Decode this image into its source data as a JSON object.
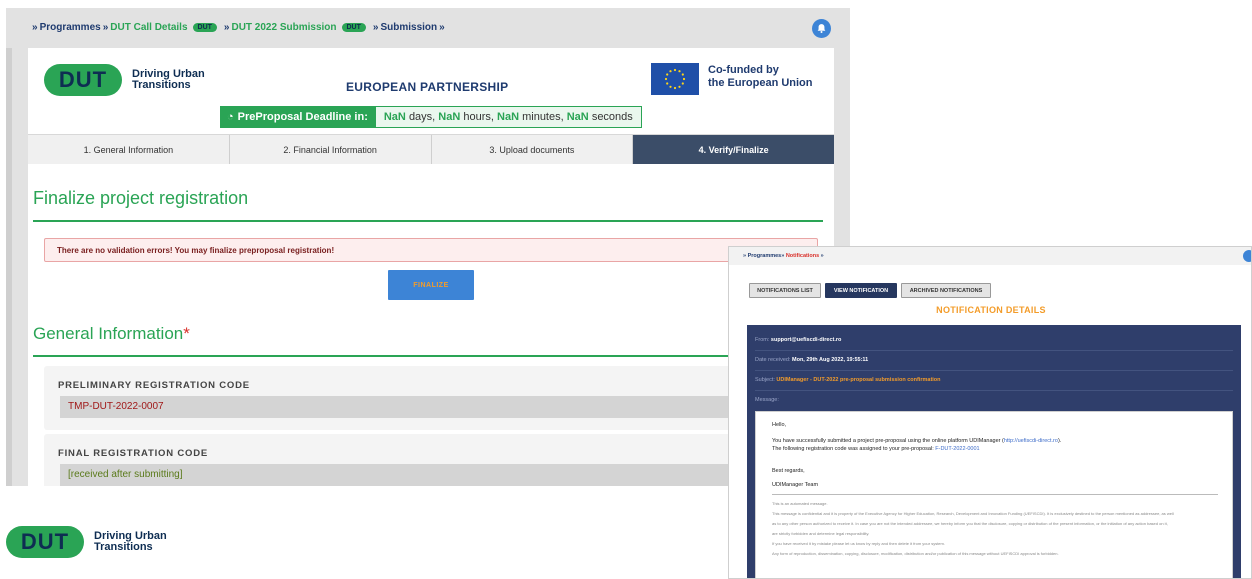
{
  "main": {
    "breadcrumb": {
      "sep1": "»",
      "programmes": "Programmes",
      "sep2": "»",
      "call_details": "DUT Call Details",
      "pill1": "DUT",
      "sep3": "»",
      "submission_2022": "DUT 2022 Submission",
      "pill2": "DUT",
      "sep4": "»",
      "submission": "Submission",
      "sep5": "»"
    },
    "logo": {
      "mark": "DUT",
      "line1": "Driving Urban",
      "line2": "Transitions"
    },
    "partnership_title": "EUROPEAN PARTNERSHIP",
    "cofunded": {
      "line1": "Co-funded by",
      "line2": "the European Union"
    },
    "deadline": {
      "label": "PreProposal Deadline in:",
      "days_val": "NaN",
      "days_unit": "days,",
      "hours_val": "NaN",
      "hours_unit": "hours,",
      "minutes_val": "NaN",
      "minutes_unit": "minutes,",
      "seconds_val": "NaN",
      "seconds_unit": "seconds"
    },
    "tabs": [
      {
        "label": "1. General Information"
      },
      {
        "label": "2. Financial Information"
      },
      {
        "label": "3. Upload documents"
      },
      {
        "label": "4. Verify/Finalize"
      }
    ],
    "finalize_heading": "Finalize project registration",
    "alert_text": "There are no validation errors! You may finalize preproposal registration!",
    "finalize_button": "FINALIZE",
    "general_heading": "General Information",
    "required_mark": "*",
    "fields": [
      {
        "label": "PRELIMINARY REGISTRATION CODE",
        "value": "TMP-DUT-2022-0007"
      },
      {
        "label": "FINAL REGISTRATION CODE",
        "value": "[received after submitting]"
      }
    ]
  },
  "bottom_logo": {
    "mark": "DUT",
    "line1": "Driving Urban",
    "line2": "Transitions"
  },
  "notification": {
    "breadcrumb": {
      "sep1": "»",
      "programmes": "Programmes",
      "sep2": "»",
      "notifications": "Notifications",
      "sep3": "»"
    },
    "tabs": [
      {
        "label": "NOTIFICATIONS LIST"
      },
      {
        "label": "VIEW NOTIFICATION"
      },
      {
        "label": "ARCHIVED NOTIFICATIONS"
      }
    ],
    "title": "NOTIFICATION DETAILS",
    "from_label": "From:",
    "from_value": "support@uefiscdi-direct.ro",
    "date_label": "Date received:",
    "date_value": "Mon, 29th Aug 2022, 19:55:11",
    "subject_label": "Subject:",
    "subject_value": "UDIManager - DUT-2022 pre-proposal submission confirmation",
    "message_label": "Message:",
    "message": {
      "greeting": "Hello,",
      "line1_a": "You have successfully submitted a project pre-proposal using the online platform UDIManager (",
      "line1_link": "http://uefiscdi-direct.ro",
      "line1_b": ").",
      "line2_a": "The following registration code was assigned to your pre-proposal:",
      "line2_code": "F-DUT-2022-0001",
      "regards": "Best regards,",
      "team": "UDIManager Team",
      "auto": "This is an automated message.",
      "disc1": "This message is confidential and it is property of the Executive Agency for Higher Education, Research, Development and Innovation Funding (UEFISCDI). It is exclusively destined to the person mentioned as addressee, as well",
      "disc2": "as to any other person authorized to receive it. In case you are not the intended addressee, we hereby inform you that the disclosure, copying or distribution of the present information, or the initiation of any action based on it,",
      "disc3": "are strictly forbidden and determine legal responsibility.",
      "disc4": "If you have received it by mistake please let us know by reply and then delete it from your system.",
      "disc5": "Any form of reproduction, dissemination, copying, disclosure, modification, distribution and/or publication of this message without UEFISCDI approval is forbidden."
    }
  }
}
